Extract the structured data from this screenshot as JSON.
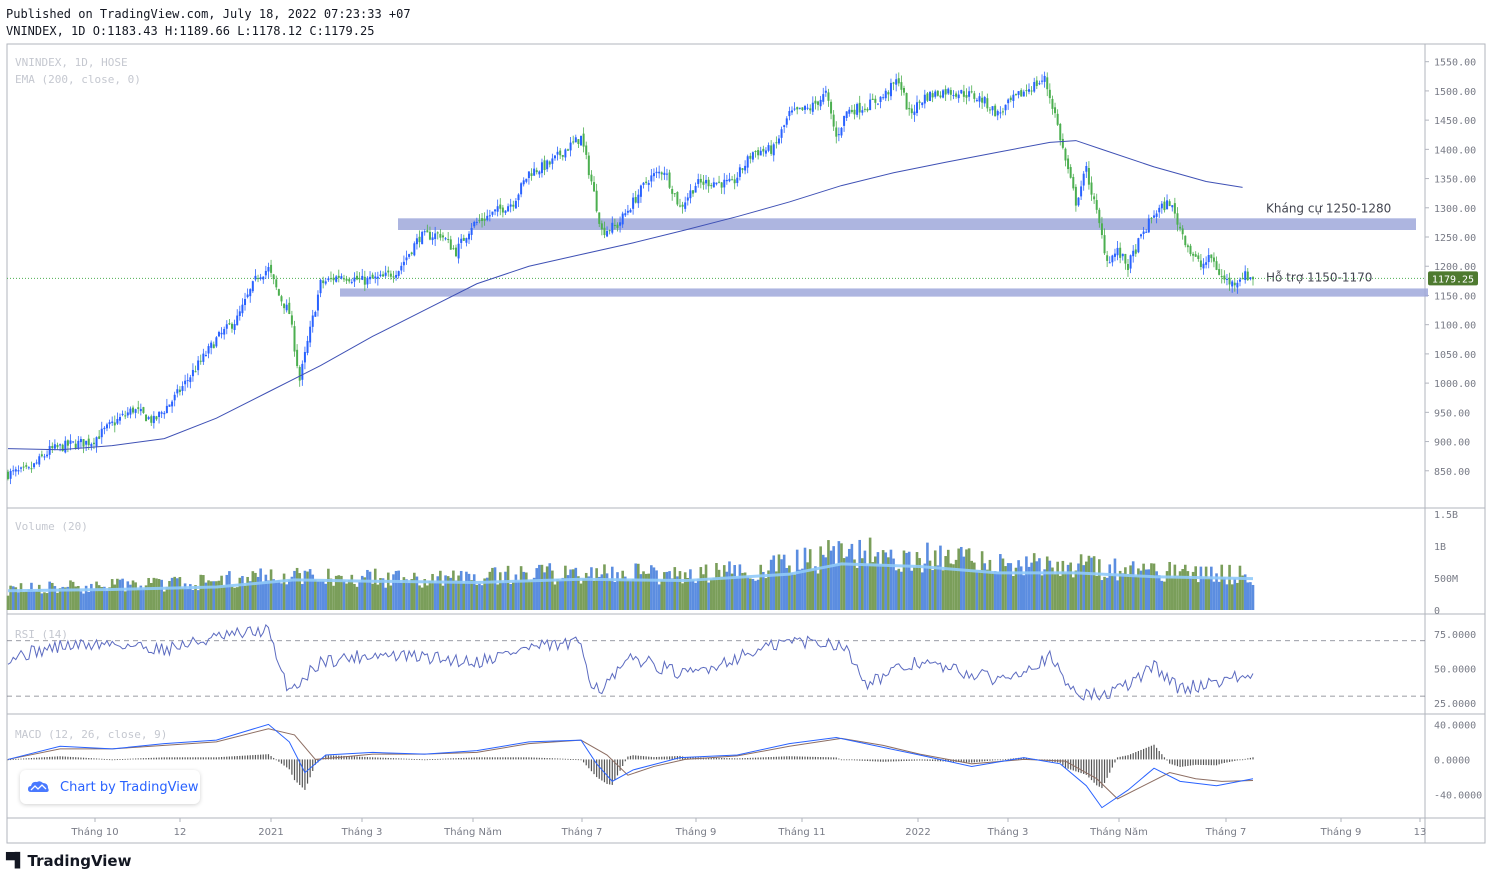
{
  "header": {
    "published": "Published on TradingView.com, July 18, 2022 07:23:33 +07",
    "ohlc": "VNINDEX, 1D O:1183.43 H:1189.66 L:1178.12 C:1179.25"
  },
  "colors": {
    "up": "#26a69a",
    "down": "#5b9a3a",
    "candle_up": "#2962ff",
    "candle_down": "#4caf50",
    "ema": "#3f51b5",
    "zone": "#9fa8da",
    "grid": "#e0e3eb",
    "axis_text": "#787b86",
    "vol_blue": "#5b8de0",
    "vol_green": "#7a9e5a",
    "vol_ma": "#90caf9",
    "rsi": "#5c6bc0",
    "macd": "#2962ff",
    "signal": "#8d6e63"
  },
  "chart_data": [
    {
      "type": "candlestick",
      "panel": "price",
      "legend": [
        "VNINDEX, 1D, HOSE",
        "EMA (200, close, 0)"
      ],
      "last_price": "1179.25",
      "ylim": [
        800,
        1570
      ],
      "y_ticks": [
        "1550.00",
        "1500.00",
        "1450.00",
        "1400.00",
        "1350.00",
        "1300.00",
        "1250.00",
        "1200.00",
        "1150.00",
        "1100.00",
        "1050.00",
        "1000.00",
        "950.00",
        "900.00",
        "850.00"
      ],
      "x_ticks": [
        "Tháng 10",
        "12",
        "2021",
        "Tháng 3",
        "Tháng Năm",
        "Tháng 7",
        "Tháng 9",
        "Tháng 11",
        "2022",
        "Tháng 3",
        "Tháng Năm",
        "Tháng 7",
        "Tháng 9",
        "13"
      ],
      "price_path": [
        [
          0,
          845
        ],
        [
          8,
          850
        ],
        [
          16,
          885
        ],
        [
          24,
          895
        ],
        [
          32,
          900
        ],
        [
          40,
          930
        ],
        [
          48,
          955
        ],
        [
          56,
          935
        ],
        [
          64,
          975
        ],
        [
          72,
          1025
        ],
        [
          80,
          1075
        ],
        [
          88,
          1110
        ],
        [
          96,
          1185
        ],
        [
          100,
          1195
        ],
        [
          104,
          1150
        ],
        [
          108,
          1120
        ],
        [
          112,
          1005
        ],
        [
          116,
          1090
        ],
        [
          120,
          1170
        ],
        [
          128,
          1185
        ],
        [
          136,
          1175
        ],
        [
          144,
          1180
        ],
        [
          150,
          1195
        ],
        [
          158,
          1250
        ],
        [
          166,
          1255
        ],
        [
          172,
          1225
        ],
        [
          178,
          1270
        ],
        [
          186,
          1290
        ],
        [
          194,
          1310
        ],
        [
          200,
          1360
        ],
        [
          208,
          1375
        ],
        [
          214,
          1400
        ],
        [
          220,
          1420
        ],
        [
          224,
          1345
        ],
        [
          228,
          1260
        ],
        [
          234,
          1270
        ],
        [
          240,
          1310
        ],
        [
          246,
          1350
        ],
        [
          252,
          1365
        ],
        [
          258,
          1300
        ],
        [
          264,
          1340
        ],
        [
          270,
          1345
        ],
        [
          278,
          1340
        ],
        [
          286,
          1395
        ],
        [
          294,
          1400
        ],
        [
          300,
          1460
        ],
        [
          308,
          1470
        ],
        [
          314,
          1495
        ],
        [
          318,
          1420
        ],
        [
          322,
          1465
        ],
        [
          330,
          1475
        ],
        [
          336,
          1490
        ],
        [
          342,
          1520
        ],
        [
          346,
          1460
        ],
        [
          352,
          1490
        ],
        [
          360,
          1500
        ],
        [
          368,
          1495
        ],
        [
          374,
          1485
        ],
        [
          380,
          1460
        ],
        [
          386,
          1485
        ],
        [
          392,
          1505
        ],
        [
          398,
          1520
        ],
        [
          402,
          1460
        ],
        [
          406,
          1380
        ],
        [
          410,
          1310
        ],
        [
          414,
          1365
        ],
        [
          418,
          1290
        ],
        [
          422,
          1210
        ],
        [
          426,
          1225
        ],
        [
          430,
          1200
        ],
        [
          434,
          1240
        ],
        [
          440,
          1290
        ],
        [
          446,
          1310
        ],
        [
          450,
          1265
        ],
        [
          454,
          1225
        ],
        [
          458,
          1200
        ],
        [
          462,
          1215
        ],
        [
          466,
          1180
        ],
        [
          470,
          1170
        ],
        [
          474,
          1185
        ],
        [
          478,
          1180
        ]
      ],
      "ema_path": [
        [
          0,
          888
        ],
        [
          20,
          886
        ],
        [
          40,
          893
        ],
        [
          60,
          905
        ],
        [
          80,
          940
        ],
        [
          100,
          985
        ],
        [
          120,
          1030
        ],
        [
          140,
          1080
        ],
        [
          160,
          1125
        ],
        [
          180,
          1170
        ],
        [
          200,
          1200
        ],
        [
          220,
          1220
        ],
        [
          240,
          1240
        ],
        [
          260,
          1262
        ],
        [
          280,
          1285
        ],
        [
          300,
          1310
        ],
        [
          320,
          1338
        ],
        [
          340,
          1360
        ],
        [
          360,
          1378
        ],
        [
          380,
          1395
        ],
        [
          400,
          1412
        ],
        [
          410,
          1415
        ],
        [
          420,
          1400
        ],
        [
          440,
          1370
        ],
        [
          460,
          1345
        ],
        [
          474,
          1335
        ]
      ],
      "zones": [
        {
          "label": "Kháng cự 1250-1280",
          "low": 1262,
          "high": 1282
        },
        {
          "label": "Hỗ trợ 1150-1170",
          "low": 1148,
          "high": 1162
        }
      ]
    },
    {
      "type": "bar",
      "panel": "volume",
      "legend": "Volume (20)",
      "y_ticks": [
        "1.5B",
        "1B",
        "500M",
        "0"
      ],
      "ylim": [
        0,
        1500
      ],
      "volume_path_millions": [
        [
          0,
          320
        ],
        [
          40,
          380
        ],
        [
          80,
          440
        ],
        [
          100,
          560
        ],
        [
          120,
          520
        ],
        [
          160,
          480
        ],
        [
          200,
          560
        ],
        [
          240,
          580
        ],
        [
          260,
          520
        ],
        [
          300,
          700
        ],
        [
          320,
          900
        ],
        [
          340,
          860
        ],
        [
          360,
          800
        ],
        [
          380,
          720
        ],
        [
          400,
          760
        ],
        [
          420,
          640
        ],
        [
          440,
          600
        ],
        [
          478,
          540
        ]
      ],
      "ma_path_millions": [
        [
          0,
          300
        ],
        [
          40,
          320
        ],
        [
          80,
          360
        ],
        [
          110,
          470
        ],
        [
          140,
          450
        ],
        [
          180,
          430
        ],
        [
          220,
          480
        ],
        [
          260,
          460
        ],
        [
          300,
          560
        ],
        [
          320,
          720
        ],
        [
          350,
          680
        ],
        [
          380,
          580
        ],
        [
          410,
          580
        ],
        [
          440,
          520
        ],
        [
          478,
          490
        ]
      ]
    },
    {
      "type": "line",
      "panel": "rsi",
      "legend": "RSI (14)",
      "y_ticks": [
        "75.0000",
        "50.0000",
        "25.0000"
      ],
      "ylim": [
        20,
        85
      ],
      "bands": [
        70,
        30
      ],
      "values_path": [
        [
          0,
          58
        ],
        [
          20,
          66
        ],
        [
          40,
          68
        ],
        [
          60,
          64
        ],
        [
          80,
          72
        ],
        [
          100,
          78
        ],
        [
          104,
          50
        ],
        [
          108,
          35
        ],
        [
          112,
          40
        ],
        [
          120,
          55
        ],
        [
          140,
          60
        ],
        [
          160,
          58
        ],
        [
          180,
          55
        ],
        [
          200,
          65
        ],
        [
          220,
          68
        ],
        [
          224,
          40
        ],
        [
          228,
          35
        ],
        [
          240,
          58
        ],
        [
          260,
          45
        ],
        [
          280,
          58
        ],
        [
          300,
          70
        ],
        [
          320,
          68
        ],
        [
          330,
          40
        ],
        [
          350,
          55
        ],
        [
          360,
          50
        ],
        [
          380,
          42
        ],
        [
          400,
          58
        ],
        [
          406,
          40
        ],
        [
          412,
          32
        ],
        [
          420,
          30
        ],
        [
          430,
          38
        ],
        [
          440,
          52
        ],
        [
          450,
          35
        ],
        [
          458,
          38
        ],
        [
          466,
          42
        ],
        [
          478,
          45
        ]
      ]
    },
    {
      "type": "line",
      "panel": "macd",
      "legend": "MACD (12, 26, close, 9)",
      "y_ticks": [
        "40.0000",
        "0.0000",
        "-40.0000"
      ],
      "ylim": [
        -60,
        45
      ],
      "macd_path": [
        [
          0,
          0
        ],
        [
          20,
          15
        ],
        [
          40,
          12
        ],
        [
          60,
          18
        ],
        [
          80,
          22
        ],
        [
          100,
          40
        ],
        [
          108,
          20
        ],
        [
          114,
          -15
        ],
        [
          122,
          5
        ],
        [
          140,
          8
        ],
        [
          160,
          6
        ],
        [
          180,
          10
        ],
        [
          200,
          20
        ],
        [
          220,
          22
        ],
        [
          226,
          -5
        ],
        [
          232,
          -25
        ],
        [
          240,
          -12
        ],
        [
          258,
          2
        ],
        [
          280,
          5
        ],
        [
          300,
          18
        ],
        [
          318,
          25
        ],
        [
          334,
          15
        ],
        [
          350,
          5
        ],
        [
          370,
          -8
        ],
        [
          390,
          2
        ],
        [
          404,
          -5
        ],
        [
          414,
          -30
        ],
        [
          420,
          -55
        ],
        [
          430,
          -35
        ],
        [
          440,
          -10
        ],
        [
          450,
          -25
        ],
        [
          464,
          -30
        ],
        [
          478,
          -22
        ]
      ],
      "signal_path": [
        [
          0,
          0
        ],
        [
          20,
          12
        ],
        [
          40,
          12
        ],
        [
          60,
          16
        ],
        [
          80,
          20
        ],
        [
          100,
          35
        ],
        [
          110,
          28
        ],
        [
          118,
          0
        ],
        [
          126,
          2
        ],
        [
          140,
          6
        ],
        [
          160,
          6
        ],
        [
          180,
          8
        ],
        [
          200,
          18
        ],
        [
          220,
          22
        ],
        [
          230,
          5
        ],
        [
          238,
          -18
        ],
        [
          248,
          -8
        ],
        [
          260,
          0
        ],
        [
          280,
          4
        ],
        [
          300,
          15
        ],
        [
          320,
          24
        ],
        [
          336,
          16
        ],
        [
          350,
          6
        ],
        [
          370,
          -5
        ],
        [
          390,
          0
        ],
        [
          406,
          -2
        ],
        [
          418,
          -22
        ],
        [
          426,
          -45
        ],
        [
          436,
          -30
        ],
        [
          446,
          -15
        ],
        [
          456,
          -22
        ],
        [
          466,
          -25
        ],
        [
          478,
          -24
        ]
      ]
    }
  ],
  "branding": {
    "chart_by": "Chart by TradingView",
    "logo": "TradingView"
  }
}
